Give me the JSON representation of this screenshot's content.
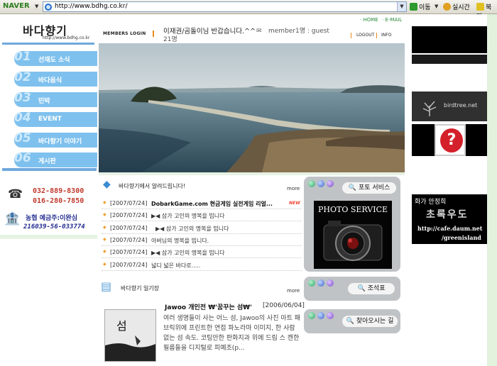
{
  "browser": {
    "brand": "NAVER",
    "address": "http://www.bdhg.co.kr/",
    "go_label": "이동",
    "realtime_label": "실시간",
    "bookmark_label": "북마"
  },
  "site": {
    "logo_text": "바다향기",
    "logo_url": "http://www.bdhg.co.kr"
  },
  "top_links": {
    "home": "· HOME",
    "email": "· E-MAIL",
    "members_login": "MEMBERS LOGIN",
    "welcome": "이재권/곰돌이님 반갑습니다.^^",
    "member_count": "member1명 : guest",
    "member_count2": "21명",
    "logout": "LOGOUT",
    "info": "INFO"
  },
  "menu": [
    {
      "num": "01",
      "label": "선재도 소식"
    },
    {
      "num": "02",
      "label": "바다음식"
    },
    {
      "num": "03",
      "label": "민박"
    },
    {
      "num": "04",
      "label": "EVENT"
    },
    {
      "num": "05",
      "label": "바다향기 이야기"
    },
    {
      "num": "06",
      "label": "게시판"
    }
  ],
  "contact": {
    "tel1": "032-889-8300",
    "tel2": "016-280-7850",
    "bank_name": "농협 예금주:이완심",
    "bank_account": "216039-56-033774"
  },
  "notices": {
    "title": "바다향기에서 알려드립니다!",
    "more": "more",
    "new_badge": "NEW",
    "items": [
      {
        "date": "[2007/07/24]",
        "title": "DobarkGame.com 현금게임 실전게임 리얼..."
      },
      {
        "date": "[2007/07/24]",
        "title": "▶◀ 삼가 고인의 명복을 빕니다"
      },
      {
        "date": "[2007/07/24]",
        "title": "▶◀ 삼가 고인의 명복을 빕니다"
      },
      {
        "date": "[2007/07/24]",
        "title": "아버님의 명복을 빕니다."
      },
      {
        "date": "[2007/07/24]",
        "title": "▶◀ 삼가 고인의 명복을 빕니다"
      },
      {
        "date": "[2007/07/24]",
        "title": "넓디 넓은 바다로....."
      }
    ]
  },
  "diary": {
    "title": "바다향기 일기장",
    "more": "more",
    "headline": "Jawoo 개인전 ₩'꿈꾸는 섬₩'",
    "date": "[2006/06/04]",
    "thumb_text": "섬",
    "text": "여러 생명들이 사는 어느 섬, Jawoo의 사진 아트 패브릭위에 프린트한 연접 파노라마 이미지, 한 사람 없는 섬 속도. 코팅안한 판화지과 위에 드림 스 캔한 필름들을 디지털로 피예조(p..."
  },
  "widgets": {
    "photo": {
      "label": "포토 서비스",
      "image_text": "PHOTO SERVICE"
    },
    "map": {
      "label": "조석표"
    },
    "directions": {
      "label": "찾아오시는 길"
    }
  },
  "ads": {
    "birdtree": "birdtree.net",
    "question": "?",
    "green": {
      "line1": "화가 안정희",
      "line2": "초록우도",
      "line3": "http://cafe.daum.net",
      "line4": "/greenisland"
    }
  },
  "colors": {
    "menu_blue": "#7fc1ee",
    "accent_orange": "#e8891a",
    "link_green": "#2a8a3a"
  }
}
